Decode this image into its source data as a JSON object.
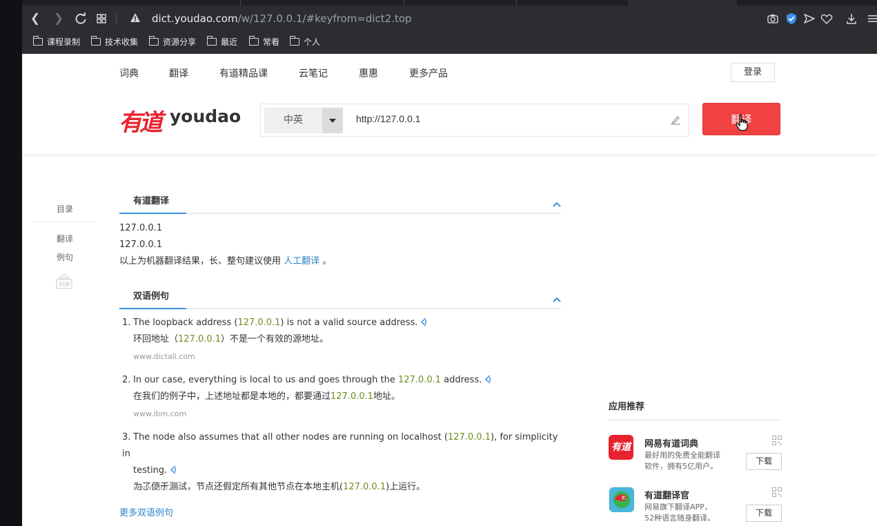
{
  "browser": {
    "url_host": "dict.youdao.com",
    "url_path": "/w/127.0.0.1/#keyfrom=dict2.top",
    "bookmarks": [
      "课程录制",
      "技术收集",
      "资源分享",
      "最近",
      "常看",
      "个人"
    ]
  },
  "topnav": {
    "items": [
      "词典",
      "翻译",
      "有道精品课",
      "云笔记",
      "惠惠",
      "更多产品"
    ],
    "login": "登录"
  },
  "logo": {
    "cn": "有道",
    "en": "youdao"
  },
  "search": {
    "lang": "中英",
    "query": "http://127.0.0.1",
    "button": "翻译"
  },
  "sidebar": {
    "toc": "目录",
    "links": [
      "翻译",
      "例句"
    ],
    "top": "TOP"
  },
  "translation": {
    "title": "有道翻译",
    "lines": [
      "127.0.0.1",
      "127.0.0.1"
    ],
    "note_prefix": "以上为机器翻译结果，长、整句建议使用 ",
    "note_link": "人工翻译",
    "note_suffix": " 。"
  },
  "examples": {
    "title": "双语例句",
    "items": [
      {
        "num": "1.",
        "en_before": "The loopback address (",
        "en_hl": "127.0.0.1",
        "en_after": ") is not a valid source address.",
        "cn_before": "环回地址（",
        "cn_hl": "127.0.0.1",
        "cn_after": "）不是一个有效的源地址。",
        "source": "www.dictall.com"
      },
      {
        "num": "2.",
        "en_before": "In our case, everything is local to us and goes through the ",
        "en_hl": "127.0.0.1",
        "en_after": " address.",
        "cn_before": "在我们的例子中，上述地址都是本地的，都要通过",
        "cn_hl": "127.0.0.1",
        "cn_after": "地址。",
        "source": "www.ibm.com"
      },
      {
        "num": "3.",
        "en_before": "The node also assumes that all other nodes are running on localhost (",
        "en_hl": "127.0.0.1",
        "en_after": "), for simplicity in",
        "en_line2": "testing.",
        "cn_before": "为了便于测试，节点还假定所有其他节点在本地主机(",
        "cn_hl": "127.0.0.1",
        "cn_after": ")上运行。",
        "source": "www.ibm.com"
      }
    ],
    "more": "更多双语例句"
  },
  "apps": {
    "title": "应用推荐",
    "items": [
      {
        "name": "网易有道词典",
        "desc1": "最好用的免费全能翻译",
        "desc2": "软件，拥有5亿用户。",
        "download": "下载",
        "icon_text": "有道"
      },
      {
        "name": "有道翻译官",
        "desc1": "网易旗下翻译APP，",
        "desc2": "52种语言随身翻译。",
        "download": "下载"
      }
    ]
  },
  "colors": {
    "brand_red": "#f24143",
    "link_blue": "#2d84c8",
    "highlight_green": "#6e8e23"
  }
}
